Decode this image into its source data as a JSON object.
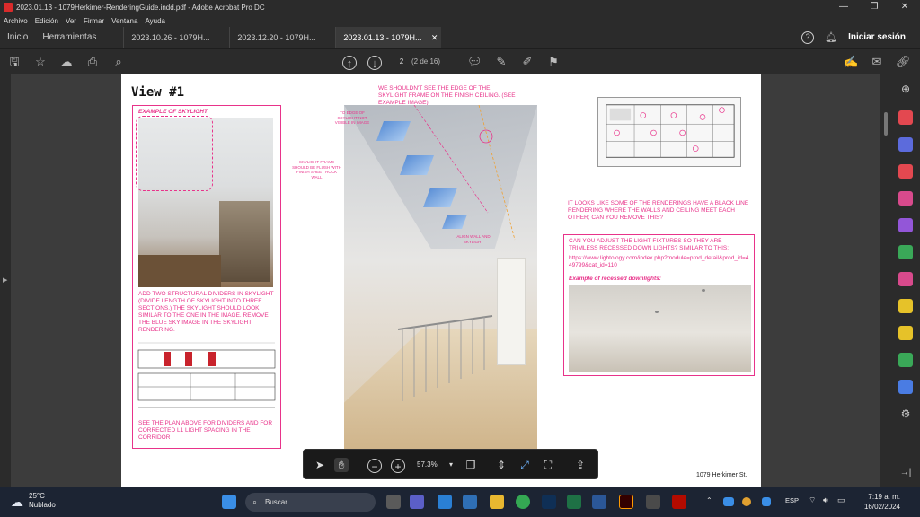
{
  "window": {
    "title": "2023.01.13 - 1079Herkimer-RenderingGuide.indd.pdf - Adobe Acrobat Pro DC",
    "controls": [
      "—",
      "❐",
      "✕"
    ]
  },
  "menu": [
    "Archivo",
    "Edición",
    "Ver",
    "Firmar",
    "Ventana",
    "Ayuda"
  ],
  "tabs": {
    "home": "Inicio",
    "tools": "Herramientas",
    "docs": [
      "2023.10.26 - 1079H...",
      "2023.12.20 - 1079H...",
      "2023.01.13 - 1079H..."
    ],
    "active_index": 2,
    "signin": "Iniciar sesión"
  },
  "toolbar": {
    "page_current": "2",
    "page_count": "(2 de 16)"
  },
  "page": {
    "title": "View #1",
    "left": {
      "caption": "EXAMPLE OF SKYLIGHT",
      "note1": "ADD TWO STRUCTURAL DIVIDERS IN SKYLIGHT (DIVIDE LENGTH OF SKYLIGHT INTO THREE SECTIONS.) THE SKYLIGHT SHOULD LOOK SIMILAR TO THE ONE IN THE IMAGE. REMOVE THE BLUE SKY IMAGE IN THE SKYLIGHT RENDERING.",
      "note2": "SEE THE PLAN ABOVE FOR DIVIDERS AND FOR CORRECTED L1 LIGHT SPACING IN THE CORRIDOR"
    },
    "center": {
      "top_note": "WE SHOULDN'T SEE THE EDGE OF THE SKYLIGHT FRAME ON THE FINISH CEILING. (SEE EXAMPLE IMAGE)",
      "annot_a": "TO EDGE OF SKYLIGHT NOT VISIBLE IN IMAGE",
      "annot_b": "SKYLIGHT FRAME SHOULD BE FLUSH WITH FINISH SHEET ROCK WALL",
      "annot_c": "ALIGN WALL AND SKYLIGHT"
    },
    "right": {
      "note1": "IT LOOKS LIKE SOME OF THE RENDERINGS HAVE A BLACK LINE RENDERING WHERE THE WALLS AND CEILING MEET EACH OTHER; CAN YOU REMOVE THIS?",
      "box_text": "CAN YOU ADJUST THE LIGHT FIXTURES SO THEY ARE TRIMLESS RECESSED DOWN LIGHTS? SIMILAR TO THIS:",
      "box_url": "https://www.lightology.com/index.php?module=prod_detail&prod_id=449799&cat_id=110",
      "box_caption": "Example of recessed downlights:"
    },
    "footer": "1079 Herkimer St."
  },
  "floatbar": {
    "zoom": "57.3%"
  },
  "taskbar": {
    "weather_temp": "25°C",
    "weather_desc": "Nublado",
    "search": "Buscar",
    "lang": "ESP",
    "time": "7:19 a. m.",
    "date": "16/02/2024"
  },
  "colors": {
    "annotation": "#e8338a",
    "chrome": "#2b2b2b",
    "taskbar": "#1c2433"
  }
}
